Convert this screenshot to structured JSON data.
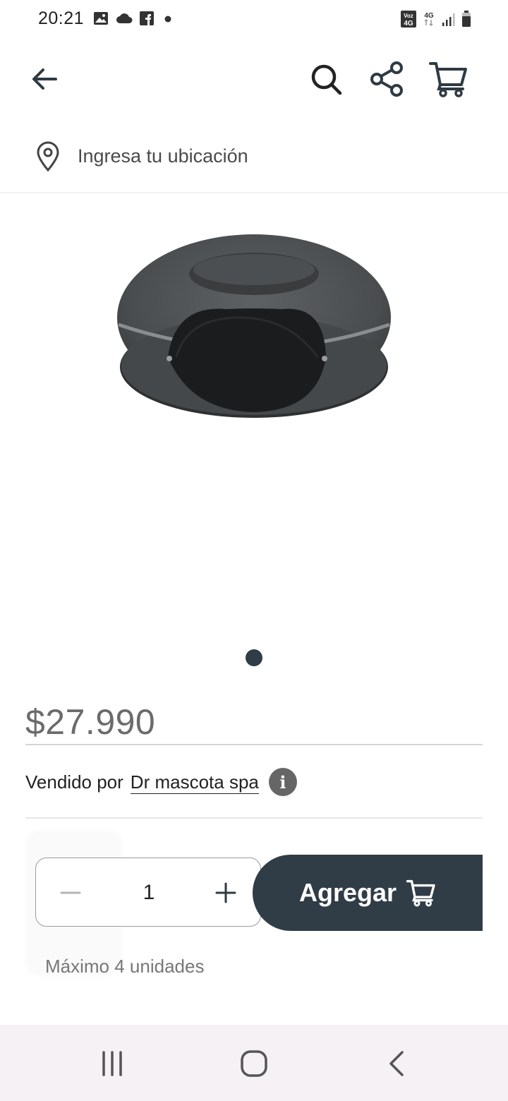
{
  "status_bar": {
    "time": "20:21",
    "left_icons": [
      "image-icon",
      "cloud-icon",
      "facebook-icon",
      "dot-icon"
    ],
    "right_icons": [
      "volte-icon",
      "4g-data-icon",
      "signal-icon",
      "battery-icon"
    ],
    "volte_label": "Voz\n4G",
    "network_label": "4G"
  },
  "header": {
    "back_icon": "arrow-left-icon",
    "search_icon": "search-icon",
    "share_icon": "share-icon",
    "cart_icon": "cart-icon"
  },
  "location": {
    "icon": "location-pin-icon",
    "text": "Ingresa tu ubicación"
  },
  "product": {
    "image": "cat-donut-bed-image",
    "price": "$27.990",
    "seller_prefix": "Vendido por",
    "seller_name": "Dr mascota spa",
    "info_icon": "i"
  },
  "carousel": {
    "current": 1,
    "total": 1
  },
  "purchase": {
    "quantity": "1",
    "add_label": "Agregar",
    "max_note": "Máximo 4 unidades"
  },
  "colors": {
    "primary": "#303c46",
    "price": "#6b6b6b",
    "nav_bg": "#f5f1f4"
  }
}
